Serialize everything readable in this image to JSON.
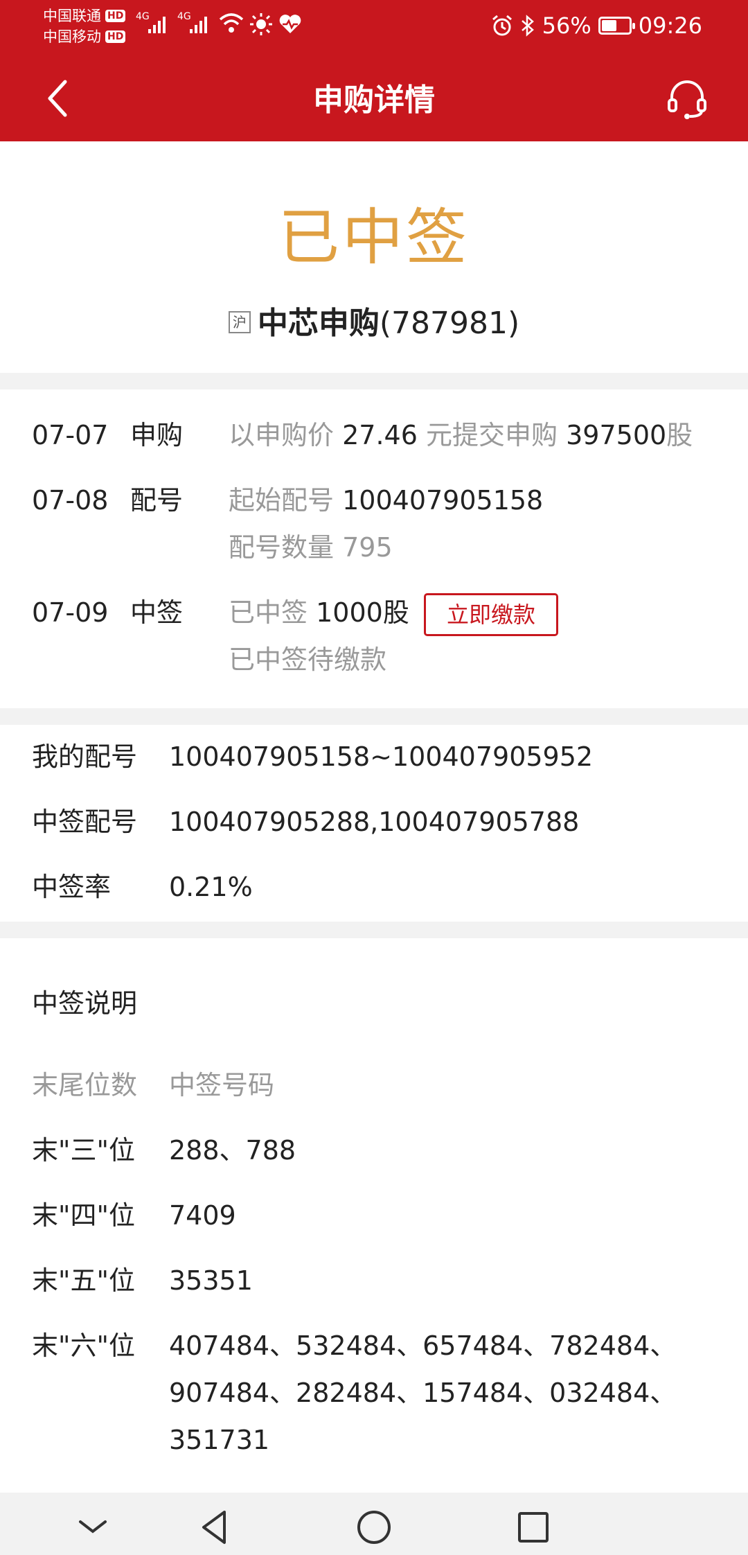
{
  "status_bar": {
    "carrier1": "中国联通",
    "carrier2": "中国移动",
    "hd": "HD",
    "net1": "4G",
    "net2": "4G",
    "battery": "56%",
    "battery_level": 0.56,
    "time": "09:26"
  },
  "header": {
    "title": "申购详情"
  },
  "summary": {
    "result": "已中签",
    "market_tag": "沪",
    "stock_name": "中芯申购",
    "stock_code": "(787981)"
  },
  "timeline": [
    {
      "date": "07-07",
      "action": "申购",
      "d1": "以申购价",
      "v1": "27.46",
      "d2": "元提交申购",
      "v2": "397500",
      "d3": "股"
    },
    {
      "date": "07-08",
      "action": "配号",
      "d1": "起始配号",
      "v1": "100407905158",
      "line2_label": "配号数量",
      "line2_value": "795"
    },
    {
      "date": "07-09",
      "action": "中签",
      "d1": "已中签",
      "v1": "1000股",
      "button": "立即缴款",
      "line2": "已中签待缴款"
    }
  ],
  "allocation": {
    "my_numbers_label": "我的配号",
    "my_numbers_value": "100407905158~100407905952",
    "winning_numbers_label": "中签配号",
    "winning_numbers_value": "100407905288,100407905788",
    "rate_label": "中签率",
    "rate_value": "0.21%"
  },
  "explanation": {
    "title": "中签说明",
    "col1": "末尾位数",
    "col2": "中签号码",
    "rows": [
      {
        "label": "末\"三\"位",
        "value": "288、788"
      },
      {
        "label": "末\"四\"位",
        "value": "7409"
      },
      {
        "label": "末\"五\"位",
        "value": "35351"
      },
      {
        "label": "末\"六\"位",
        "line1": "407484、532484、657484、782484、",
        "line2": "907484、282484、157484、032484、",
        "line3": "351731"
      }
    ]
  },
  "colors": {
    "brand_red": "#c8171e",
    "result_gold": "#e0a042",
    "muted": "#999999"
  }
}
